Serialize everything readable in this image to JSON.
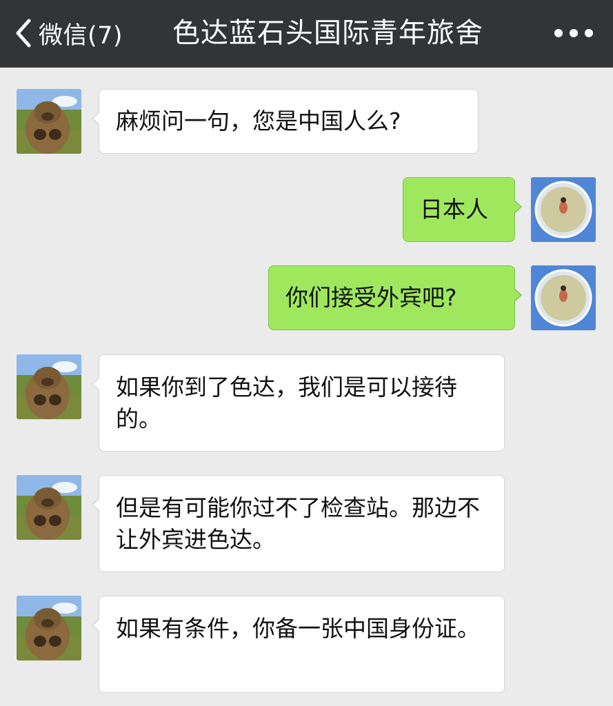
{
  "header": {
    "back_label": "微信(7)",
    "title": "色达蓝石头国际青年旅舍",
    "more_icon": "more-dots-icon"
  },
  "messages": [
    {
      "side": "left",
      "text": "麻烦问一句，您是中国人么?"
    },
    {
      "side": "right",
      "text": "日本人"
    },
    {
      "side": "right",
      "text": "你们接受外宾吧?"
    },
    {
      "side": "left",
      "text": "如果你到了色达，我们是可以接待的。"
    },
    {
      "side": "left",
      "text": "但是有可能你过不了检查站。那边不让外宾进色达。"
    },
    {
      "side": "left",
      "text": "如果有条件，你备一张中国身份证。"
    }
  ],
  "colors": {
    "navbar": "#323436",
    "background": "#ebebeb",
    "bubble_self": "#9fe85e",
    "bubble_other": "#ffffff"
  }
}
